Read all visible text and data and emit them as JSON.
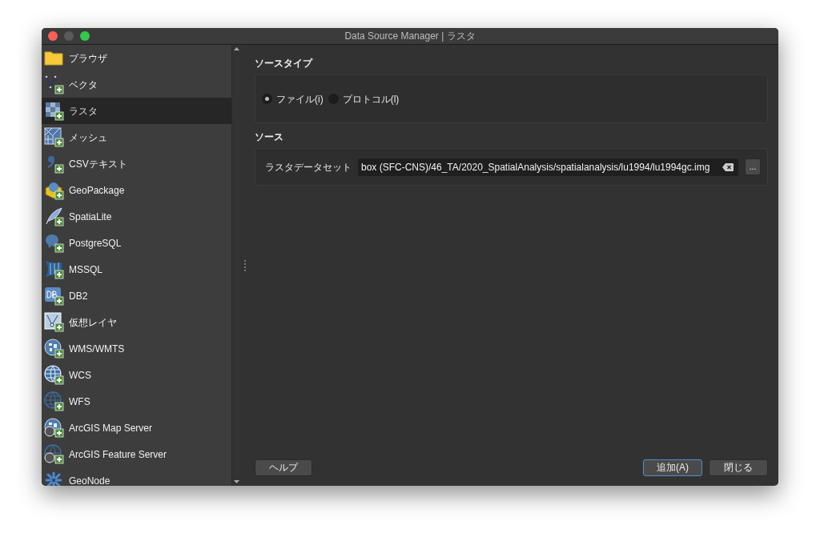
{
  "window": {
    "title": "Data Source Manager | ラスタ"
  },
  "sidebar": {
    "items": [
      {
        "label": "ブラウザ",
        "selected": false
      },
      {
        "label": "ベクタ",
        "selected": false
      },
      {
        "label": "ラスタ",
        "selected": true
      },
      {
        "label": "メッシュ",
        "selected": false
      },
      {
        "label": "CSVテキスト",
        "selected": false
      },
      {
        "label": "GeoPackage",
        "selected": false
      },
      {
        "label": "SpatiaLite",
        "selected": false
      },
      {
        "label": "PostgreSQL",
        "selected": false
      },
      {
        "label": "MSSQL",
        "selected": false
      },
      {
        "label": "DB2",
        "selected": false
      },
      {
        "label": "仮想レイヤ",
        "selected": false
      },
      {
        "label": "WMS/WMTS",
        "selected": false
      },
      {
        "label": "WCS",
        "selected": false
      },
      {
        "label": "WFS",
        "selected": false
      },
      {
        "label": "ArcGIS Map Server",
        "selected": false
      },
      {
        "label": "ArcGIS Feature Server",
        "selected": false
      },
      {
        "label": "GeoNode",
        "selected": false
      }
    ]
  },
  "source_type": {
    "title": "ソースタイプ",
    "options": [
      {
        "label": "ファイル(i)",
        "selected": true
      },
      {
        "label": "プロトコル(l)",
        "selected": false
      }
    ]
  },
  "source": {
    "title": "ソース",
    "label": "ラスタデータセット",
    "value": "box (SFC-CNS)/46_TA/2020_SpatialAnalysis/spatialanalysis/lu1994/lu1994gc.img",
    "browse": "..."
  },
  "buttons": [
    {
      "label": "ヘルプ",
      "default": false
    },
    {
      "label": "追加(A)",
      "default": true
    },
    {
      "label": "閉じる",
      "default": false
    }
  ]
}
